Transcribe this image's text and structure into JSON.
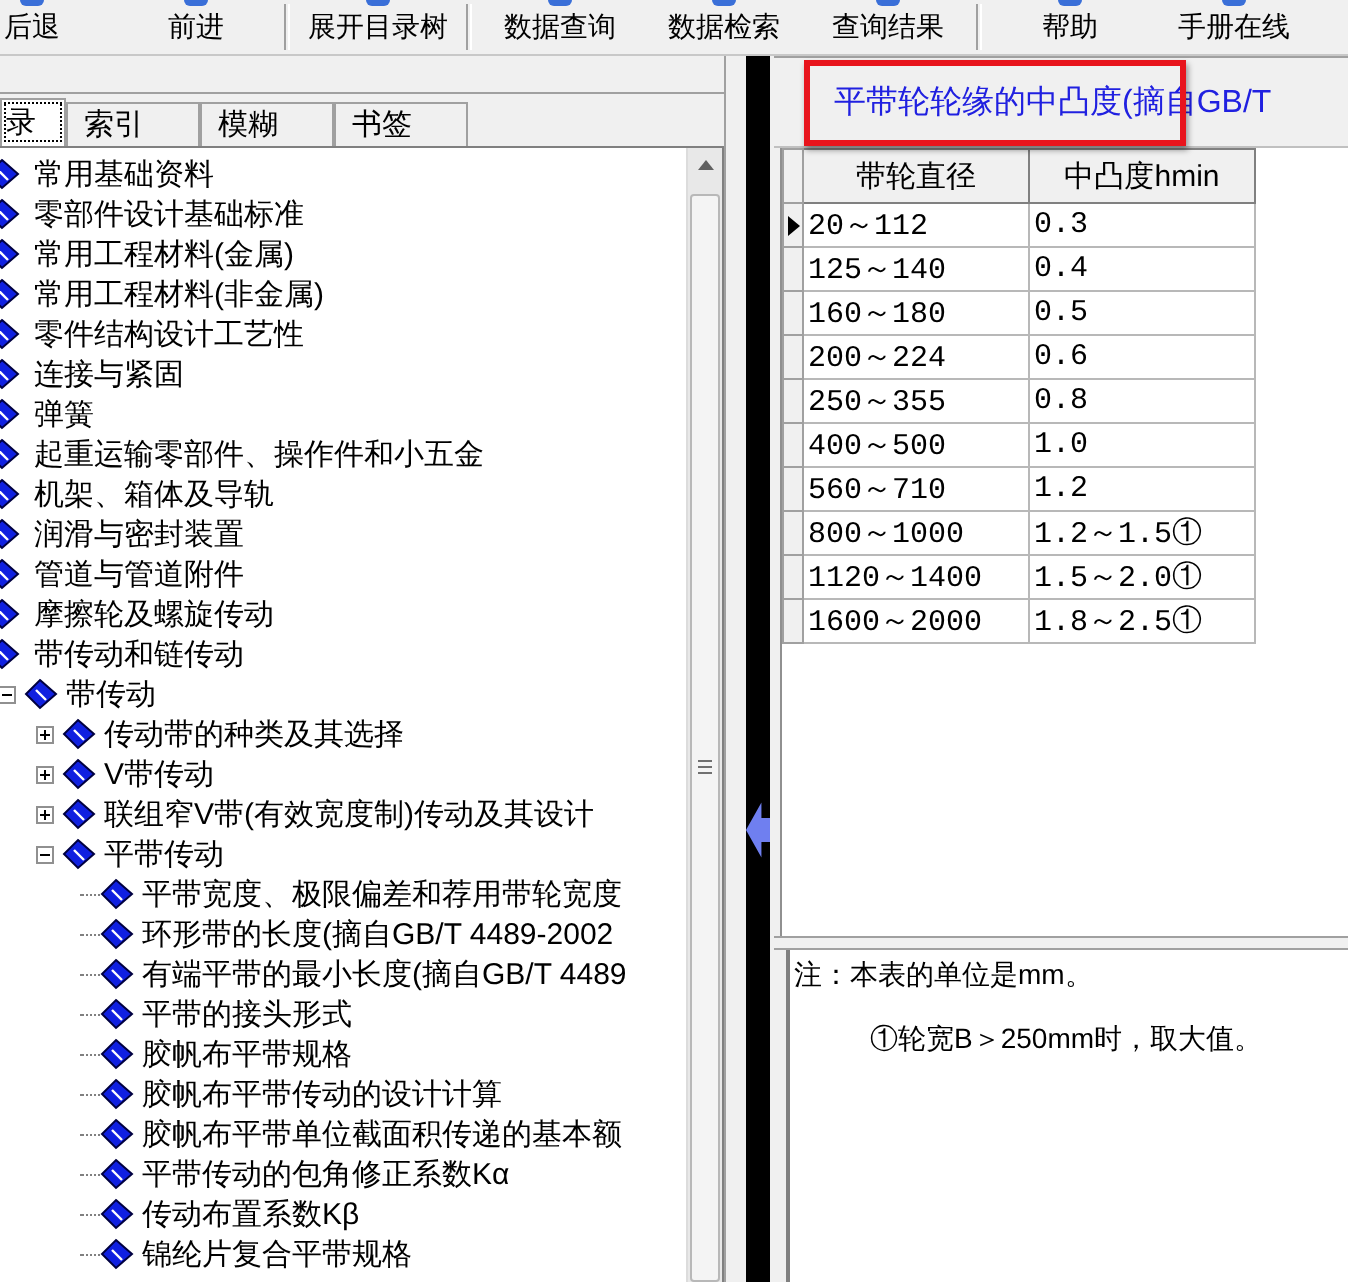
{
  "toolbar": {
    "groups": [
      [
        "后退",
        "前进"
      ],
      [
        "展开目录树"
      ],
      [
        "数据查询",
        "数据检索",
        "查询结果"
      ],
      [
        "帮助",
        "手册在线"
      ]
    ]
  },
  "tabs": [
    {
      "label": "录",
      "selected": true
    },
    {
      "label": "索引",
      "selected": false
    },
    {
      "label": "模糊",
      "selected": false
    },
    {
      "label": "书签",
      "selected": false
    }
  ],
  "tree": [
    {
      "label": "常用基础资料"
    },
    {
      "label": "零部件设计基础标准"
    },
    {
      "label": "常用工程材料(金属)"
    },
    {
      "label": "常用工程材料(非金属)"
    },
    {
      "label": "零件结构设计工艺性"
    },
    {
      "label": "连接与紧固"
    },
    {
      "label": "弹簧"
    },
    {
      "label": "起重运输零部件、操作件和小五金"
    },
    {
      "label": "机架、箱体及导轨"
    },
    {
      "label": "润滑与密封装置"
    },
    {
      "label": "管道与管道附件"
    },
    {
      "label": "摩擦轮及螺旋传动"
    },
    {
      "label": "带传动和链传动",
      "children": [
        {
          "label": "带传动",
          "expanded": true,
          "children": [
            {
              "label": "传动带的种类及其选择",
              "expanded": false
            },
            {
              "label": "V带传动",
              "expanded": false
            },
            {
              "label": "联组窄V带(有效宽度制)传动及其设计",
              "expanded": false
            },
            {
              "label": "平带传动",
              "expanded": true,
              "children": [
                {
                  "label": "平带宽度、极限偏差和荐用带轮宽度"
                },
                {
                  "label": "环形带的长度(摘自GB/T 4489-2002"
                },
                {
                  "label": "有端平带的最小长度(摘自GB/T 4489"
                },
                {
                  "label": "平带的接头形式"
                },
                {
                  "label": "胶帆布平带规格"
                },
                {
                  "label": "胶帆布平带传动的设计计算"
                },
                {
                  "label": "胶帆布平带单位截面积传递的基本额"
                },
                {
                  "label": "平带传动的包角修正系数Kα"
                },
                {
                  "label": "传动布置系数Kβ"
                },
                {
                  "label": "锦纶片复合平带规格"
                }
              ]
            }
          ]
        }
      ]
    }
  ],
  "content": {
    "title": "平带轮轮缘的中凸度(摘自GB/T",
    "highlighted": true,
    "table": {
      "columns": [
        "带轮直径",
        "中凸度hmin"
      ],
      "rows": [
        {
          "cells": [
            "20～112",
            "0.3"
          ],
          "selected": true
        },
        {
          "cells": [
            "125～140",
            "0.4"
          ],
          "selected": false
        },
        {
          "cells": [
            "160～180",
            "0.5"
          ],
          "selected": false
        },
        {
          "cells": [
            "200～224",
            "0.6"
          ],
          "selected": false
        },
        {
          "cells": [
            "250～355",
            "0.8"
          ],
          "selected": false
        },
        {
          "cells": [
            "400～500",
            "1.0"
          ],
          "selected": false
        },
        {
          "cells": [
            "560～710",
            "1.2"
          ],
          "selected": false
        },
        {
          "cells": [
            "800～1000",
            "1.2～1.5①"
          ],
          "selected": false
        },
        {
          "cells": [
            "1120～1400",
            "1.5～2.0①"
          ],
          "selected": false
        },
        {
          "cells": [
            "1600～2000",
            "1.8～2.5①"
          ],
          "selected": false
        }
      ]
    },
    "note": [
      {
        "kind": "heading",
        "text": "注：本表的单位是mm。"
      },
      {
        "kind": "item",
        "text": "①轮宽B＞250mm时，取大值。"
      }
    ]
  }
}
